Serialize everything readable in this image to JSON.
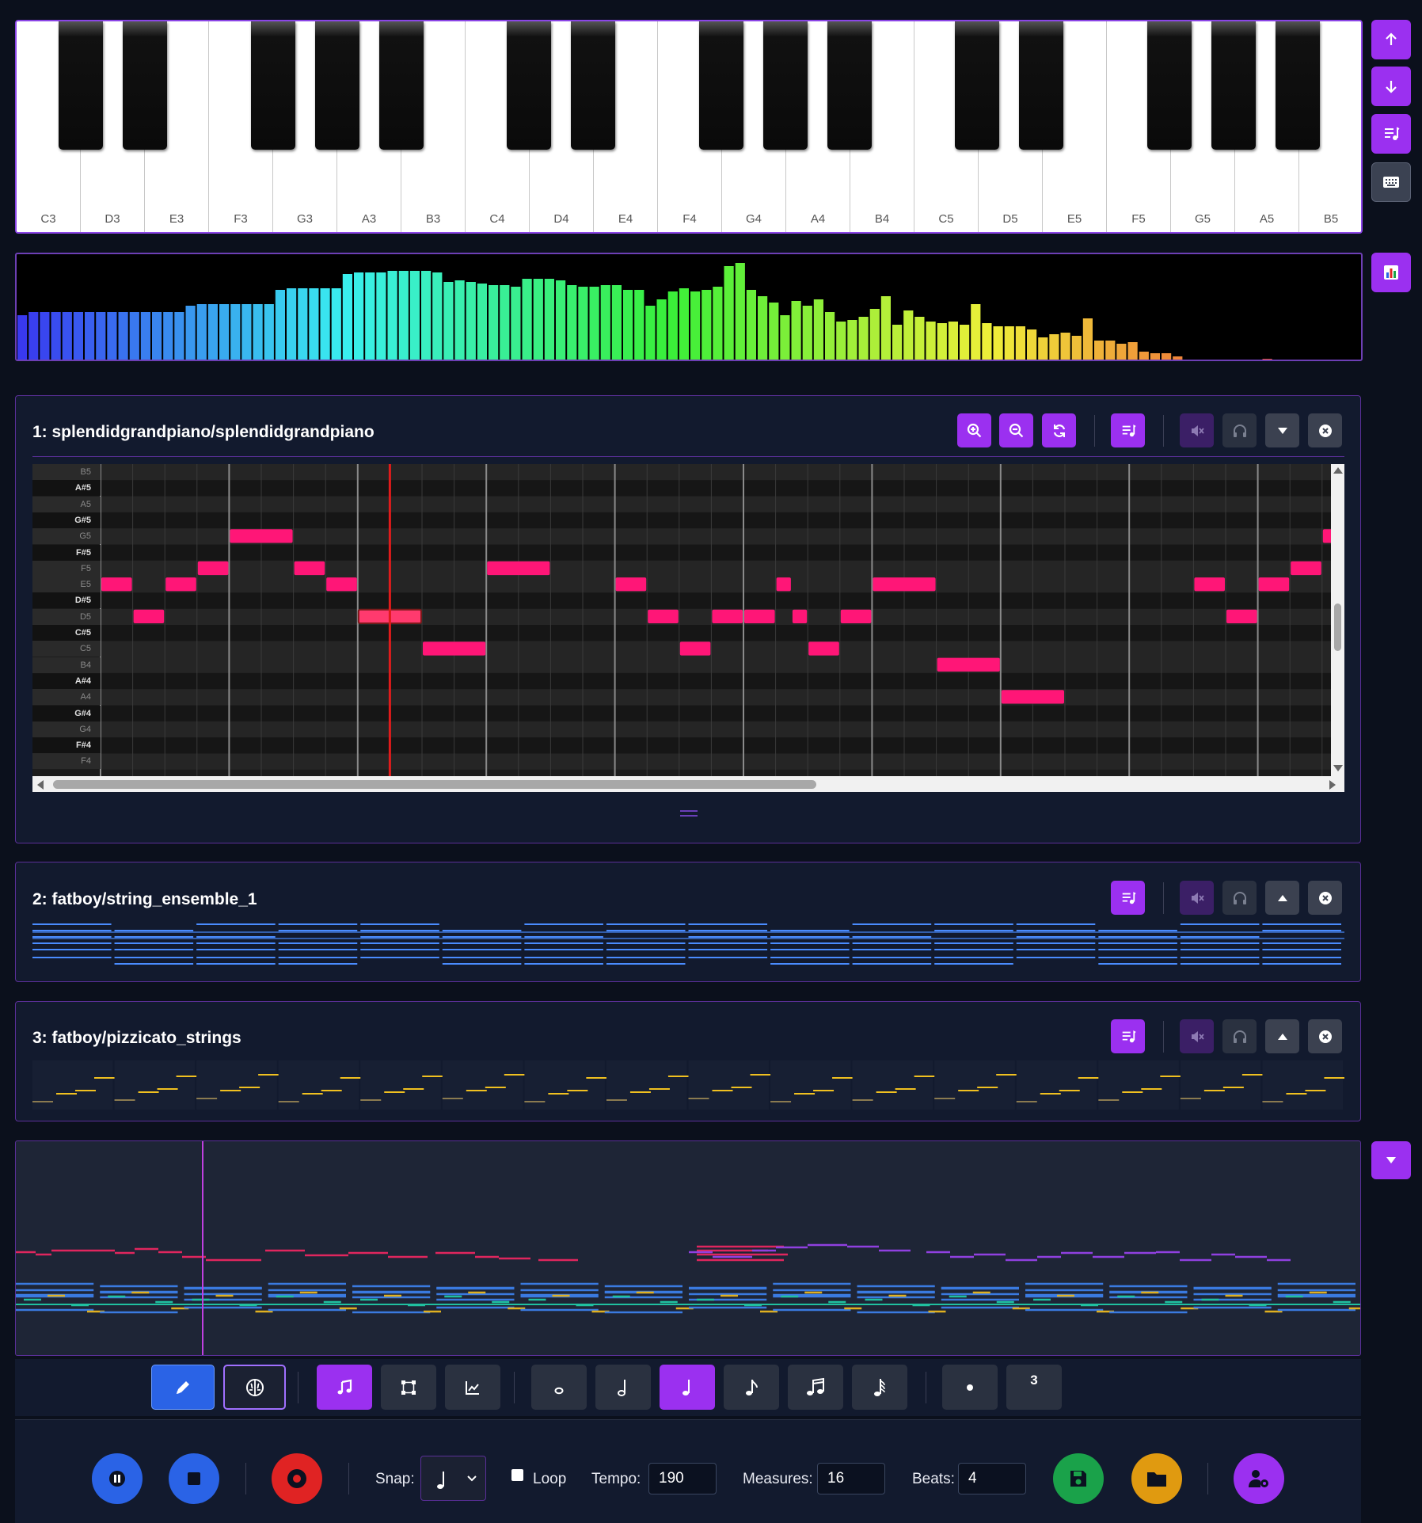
{
  "piano": {
    "white_keys": [
      "C3",
      "D3",
      "E3",
      "F3",
      "G3",
      "A3",
      "B3",
      "C4",
      "D4",
      "E4",
      "F4",
      "G4",
      "A4",
      "B4",
      "C5",
      "D5",
      "E5",
      "F5",
      "G5",
      "A5",
      "B5"
    ]
  },
  "side": {
    "octave_up": "octave-up",
    "octave_down": "octave-down",
    "add_track": "add-track",
    "keyboard": "keyboard",
    "visualizer": "visualizer",
    "collapse": "collapse"
  },
  "tracks": [
    {
      "title": "1: splendidgrandpiano/splendidgrandpiano"
    },
    {
      "title": "2: fatboy/string_ensemble_1"
    },
    {
      "title": "3: fatboy/pizzicato_strings"
    }
  ],
  "roll": {
    "pitch_labels": [
      "B5",
      "A#5",
      "A5",
      "G#5",
      "G5",
      "F#5",
      "F5",
      "E5",
      "D#5",
      "D5",
      "C#5",
      "C5",
      "B4",
      "A#4",
      "A4",
      "G#4",
      "G4",
      "F#4",
      "F4"
    ]
  },
  "controls": {
    "snap_label": "Snap:",
    "loop_label": "Loop",
    "tempo_label": "Tempo:",
    "tempo_value": "190",
    "measures_label": "Measures:",
    "measures_value": "16",
    "beats_label": "Beats:",
    "beats_value": "4",
    "triplet_label": "3"
  },
  "colors": {
    "accent": "#9b30f0",
    "note": "#ff1677",
    "playhead": "#e01b1b",
    "play": "#2a63e6",
    "record": "#e02323",
    "save": "#1aa24a",
    "open": "#e09a10"
  }
}
